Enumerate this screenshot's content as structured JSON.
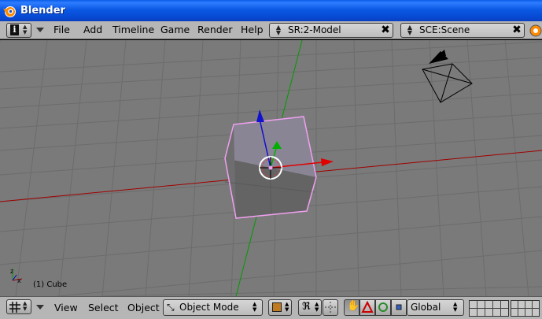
{
  "window": {
    "title": "Blender"
  },
  "top_menu": {
    "items": [
      "File",
      "Add",
      "Timeline",
      "Game",
      "Render",
      "Help"
    ],
    "screen_field": "SR:2-Model",
    "scene_field": "SCE:Scene",
    "close_glyph": "✖"
  },
  "viewport": {
    "object_label": "(1) Cube",
    "background_color": "#7a7a7a",
    "grid_color": "#6e6e6e",
    "x_axis_color": "#a00000",
    "y_axis_color": "#009a00",
    "selection_outline_color": "#f0a0f0"
  },
  "bottom_menu": {
    "items": [
      "View",
      "Select",
      "Object"
    ],
    "mode_select": "Object Mode",
    "orientation_select": "Global"
  },
  "icons": {
    "titlebar": "blender-logo-icon",
    "window_type": "info-icon",
    "viewport_type": "grid-view-icon",
    "pivot": "pivot-icon",
    "manipulator": "hand-icon"
  }
}
